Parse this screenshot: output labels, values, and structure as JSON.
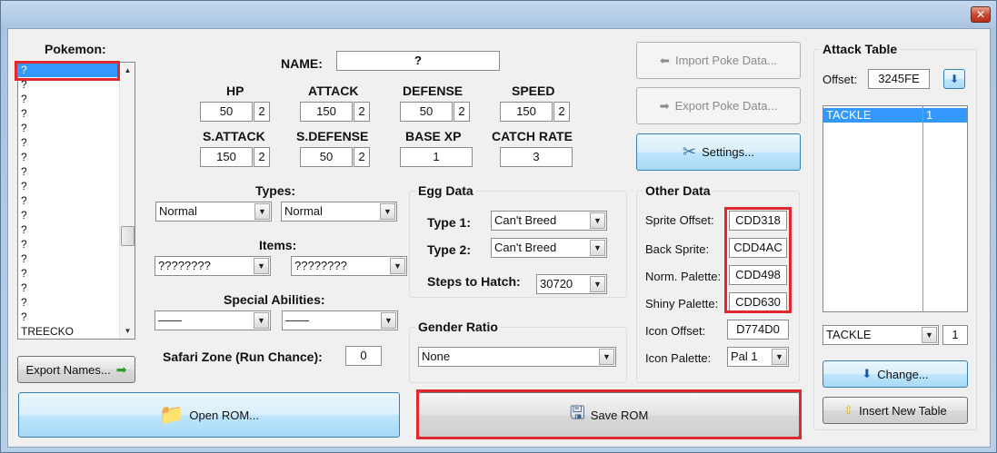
{
  "window": {
    "close_glyph": "✕"
  },
  "pokemon_list": {
    "label": "Pokemon:",
    "items": [
      "?",
      "?",
      "?",
      "?",
      "?",
      "?",
      "?",
      "?",
      "?",
      "?",
      "?",
      "?",
      "?",
      "?",
      "?",
      "?",
      "?",
      "?",
      "TREECKO"
    ],
    "selected_index": 0
  },
  "export_names_label": "Export Names...",
  "name": {
    "label": "NAME:",
    "value": "?"
  },
  "stats": {
    "hp": {
      "label": "HP",
      "value": "50",
      "digits": "2"
    },
    "attack": {
      "label": "ATTACK",
      "value": "150",
      "digits": "2"
    },
    "defense": {
      "label": "DEFENSE",
      "value": "50",
      "digits": "2"
    },
    "speed": {
      "label": "SPEED",
      "value": "150",
      "digits": "2"
    },
    "sattack": {
      "label": "S.ATTACK",
      "value": "150",
      "digits": "2"
    },
    "sdefense": {
      "label": "S.DEFENSE",
      "value": "50",
      "digits": "2"
    },
    "base_xp": {
      "label": "BASE XP",
      "value": "1"
    },
    "catch_rate": {
      "label": "CATCH RATE",
      "value": "3"
    }
  },
  "types": {
    "label": "Types:",
    "type1": "Normal",
    "type2": "Normal"
  },
  "items": {
    "label": "Items:",
    "item1": "????????",
    "item2": "????????"
  },
  "abilities": {
    "label": "Special Abilities:",
    "ability1": "——",
    "ability2": "——"
  },
  "safari": {
    "label": "Safari Zone (Run Chance):",
    "value": "0"
  },
  "egg_data": {
    "title": "Egg Data",
    "type1_label": "Type 1:",
    "type1": "Can't Breed",
    "type2_label": "Type 2:",
    "type2": "Can't Breed",
    "steps_label": "Steps to Hatch:",
    "steps": "30720"
  },
  "gender": {
    "title": "Gender Ratio",
    "value": "None"
  },
  "buttons": {
    "import": "Import Poke Data...",
    "export": "Export Poke Data...",
    "settings": "Settings...",
    "open_rom": "Open ROM...",
    "save_rom": "Save ROM",
    "change": "Change...",
    "insert_table": "Insert New Table"
  },
  "other_data": {
    "title": "Other Data",
    "sprite_offset_label": "Sprite Offset:",
    "sprite_offset": "CDD318",
    "back_sprite_label": "Back Sprite:",
    "back_sprite": "CDD4AC",
    "norm_palette_label": "Norm. Palette:",
    "norm_palette": "CDD498",
    "shiny_palette_label": "Shiny Palette:",
    "shiny_palette": "CDD630",
    "icon_offset_label": "Icon Offset:",
    "icon_offset": "D774D0",
    "icon_palette_label": "Icon Palette:",
    "icon_palette": "Pal 1"
  },
  "attack_table": {
    "title": "Attack Table",
    "offset_label": "Offset:",
    "offset": "3245FE",
    "rows": [
      {
        "move": "TACKLE",
        "level": "1"
      }
    ],
    "move_select": "TACKLE",
    "level_value": "1"
  },
  "colors": {
    "highlight": "#e0282e",
    "selection": "#3399ff"
  }
}
